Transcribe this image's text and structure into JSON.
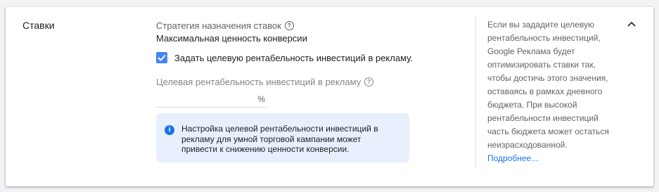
{
  "section": {
    "title": "Ставки"
  },
  "bidding": {
    "strategy_label": "Стратегия назначения ставок",
    "strategy_value": "Максимальная ценность конверсии",
    "checkbox_label": "Задать целевую рентабельность инвестиций в рекламу.",
    "checkbox_checked": true,
    "target_label": "Целевая рентабельность инвестиций в рекламу",
    "target_value": "",
    "target_suffix": "%",
    "info_text": "Настройка целевой рентабельности инвестиций в рекламу для умной торговой кампании может привести к снижению ценности конверсии."
  },
  "side_help": {
    "text": "Если вы зададите целевую\nрентабельность инвестиций,\nGoogle Реклама будет\nоптимизировать ставки так,\nчтобы достичь этого значения,\nоставаясь в рамках дневного\nбюджета. При высокой\nрентабельности инвестиций\nчасть бюджета может остаться\nнеизрасходованной.",
    "link": "Подробнее..."
  },
  "icons": {
    "help": "help-circle-icon",
    "info": "info-icon",
    "check": "check-icon",
    "collapse": "chevron-up-icon"
  },
  "colors": {
    "accent": "#1a73e8",
    "checkbox": "#4285f4",
    "info_bg": "#e8f0fe"
  }
}
